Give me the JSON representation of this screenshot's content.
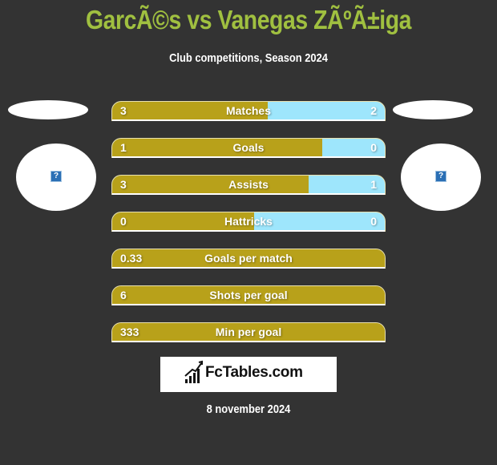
{
  "header": {
    "title": "GarcÃ©s vs Vanegas ZÃºÃ±iga",
    "subtitle": "Club competitions, Season 2024"
  },
  "teams": {
    "left": {
      "logo_icon": "broken-image-icon",
      "logo_glyph": "?"
    },
    "right": {
      "logo_icon": "broken-image-icon",
      "logo_glyph": "?"
    }
  },
  "colors": {
    "background": "#333333",
    "title": "#a0c040",
    "left_bar": "#b8a11a",
    "right_bar": "#9ee6fc",
    "text": "#ffffff"
  },
  "stats": [
    {
      "label": "Matches",
      "left": "3",
      "right": "2",
      "left_share": 0.57
    },
    {
      "label": "Goals",
      "left": "1",
      "right": "0",
      "left_share": 0.77
    },
    {
      "label": "Assists",
      "left": "3",
      "right": "1",
      "left_share": 0.72
    },
    {
      "label": "Hattricks",
      "left": "0",
      "right": "0",
      "left_share": 0.52
    },
    {
      "label": "Goals per match",
      "left": "0.33",
      "right": "",
      "left_share": 1
    },
    {
      "label": "Shots per goal",
      "left": "6",
      "right": "",
      "left_share": 1
    },
    {
      "label": "Min per goal",
      "left": "333",
      "right": "",
      "left_share": 1
    }
  ],
  "brand": {
    "name": "FcTables.com",
    "icon": "bar-chart-trend-icon"
  },
  "footer": {
    "date": "8 november 2024"
  }
}
